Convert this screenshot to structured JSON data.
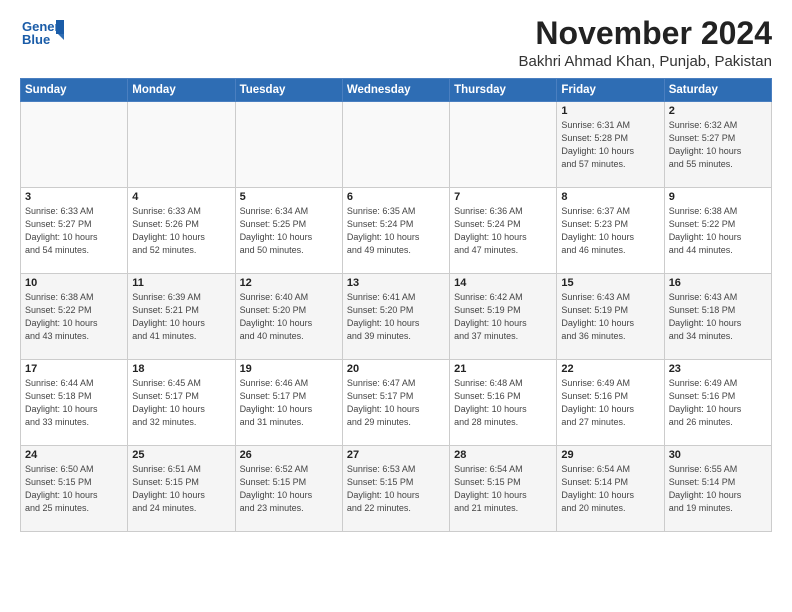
{
  "logo": {
    "line1": "General",
    "line2": "Blue"
  },
  "header": {
    "month": "November 2024",
    "location": "Bakhri Ahmad Khan, Punjab, Pakistan"
  },
  "weekdays": [
    "Sunday",
    "Monday",
    "Tuesday",
    "Wednesday",
    "Thursday",
    "Friday",
    "Saturday"
  ],
  "weeks": [
    [
      {
        "day": "",
        "info": ""
      },
      {
        "day": "",
        "info": ""
      },
      {
        "day": "",
        "info": ""
      },
      {
        "day": "",
        "info": ""
      },
      {
        "day": "",
        "info": ""
      },
      {
        "day": "1",
        "info": "Sunrise: 6:31 AM\nSunset: 5:28 PM\nDaylight: 10 hours\nand 57 minutes."
      },
      {
        "day": "2",
        "info": "Sunrise: 6:32 AM\nSunset: 5:27 PM\nDaylight: 10 hours\nand 55 minutes."
      }
    ],
    [
      {
        "day": "3",
        "info": "Sunrise: 6:33 AM\nSunset: 5:27 PM\nDaylight: 10 hours\nand 54 minutes."
      },
      {
        "day": "4",
        "info": "Sunrise: 6:33 AM\nSunset: 5:26 PM\nDaylight: 10 hours\nand 52 minutes."
      },
      {
        "day": "5",
        "info": "Sunrise: 6:34 AM\nSunset: 5:25 PM\nDaylight: 10 hours\nand 50 minutes."
      },
      {
        "day": "6",
        "info": "Sunrise: 6:35 AM\nSunset: 5:24 PM\nDaylight: 10 hours\nand 49 minutes."
      },
      {
        "day": "7",
        "info": "Sunrise: 6:36 AM\nSunset: 5:24 PM\nDaylight: 10 hours\nand 47 minutes."
      },
      {
        "day": "8",
        "info": "Sunrise: 6:37 AM\nSunset: 5:23 PM\nDaylight: 10 hours\nand 46 minutes."
      },
      {
        "day": "9",
        "info": "Sunrise: 6:38 AM\nSunset: 5:22 PM\nDaylight: 10 hours\nand 44 minutes."
      }
    ],
    [
      {
        "day": "10",
        "info": "Sunrise: 6:38 AM\nSunset: 5:22 PM\nDaylight: 10 hours\nand 43 minutes."
      },
      {
        "day": "11",
        "info": "Sunrise: 6:39 AM\nSunset: 5:21 PM\nDaylight: 10 hours\nand 41 minutes."
      },
      {
        "day": "12",
        "info": "Sunrise: 6:40 AM\nSunset: 5:20 PM\nDaylight: 10 hours\nand 40 minutes."
      },
      {
        "day": "13",
        "info": "Sunrise: 6:41 AM\nSunset: 5:20 PM\nDaylight: 10 hours\nand 39 minutes."
      },
      {
        "day": "14",
        "info": "Sunrise: 6:42 AM\nSunset: 5:19 PM\nDaylight: 10 hours\nand 37 minutes."
      },
      {
        "day": "15",
        "info": "Sunrise: 6:43 AM\nSunset: 5:19 PM\nDaylight: 10 hours\nand 36 minutes."
      },
      {
        "day": "16",
        "info": "Sunrise: 6:43 AM\nSunset: 5:18 PM\nDaylight: 10 hours\nand 34 minutes."
      }
    ],
    [
      {
        "day": "17",
        "info": "Sunrise: 6:44 AM\nSunset: 5:18 PM\nDaylight: 10 hours\nand 33 minutes."
      },
      {
        "day": "18",
        "info": "Sunrise: 6:45 AM\nSunset: 5:17 PM\nDaylight: 10 hours\nand 32 minutes."
      },
      {
        "day": "19",
        "info": "Sunrise: 6:46 AM\nSunset: 5:17 PM\nDaylight: 10 hours\nand 31 minutes."
      },
      {
        "day": "20",
        "info": "Sunrise: 6:47 AM\nSunset: 5:17 PM\nDaylight: 10 hours\nand 29 minutes."
      },
      {
        "day": "21",
        "info": "Sunrise: 6:48 AM\nSunset: 5:16 PM\nDaylight: 10 hours\nand 28 minutes."
      },
      {
        "day": "22",
        "info": "Sunrise: 6:49 AM\nSunset: 5:16 PM\nDaylight: 10 hours\nand 27 minutes."
      },
      {
        "day": "23",
        "info": "Sunrise: 6:49 AM\nSunset: 5:16 PM\nDaylight: 10 hours\nand 26 minutes."
      }
    ],
    [
      {
        "day": "24",
        "info": "Sunrise: 6:50 AM\nSunset: 5:15 PM\nDaylight: 10 hours\nand 25 minutes."
      },
      {
        "day": "25",
        "info": "Sunrise: 6:51 AM\nSunset: 5:15 PM\nDaylight: 10 hours\nand 24 minutes."
      },
      {
        "day": "26",
        "info": "Sunrise: 6:52 AM\nSunset: 5:15 PM\nDaylight: 10 hours\nand 23 minutes."
      },
      {
        "day": "27",
        "info": "Sunrise: 6:53 AM\nSunset: 5:15 PM\nDaylight: 10 hours\nand 22 minutes."
      },
      {
        "day": "28",
        "info": "Sunrise: 6:54 AM\nSunset: 5:15 PM\nDaylight: 10 hours\nand 21 minutes."
      },
      {
        "day": "29",
        "info": "Sunrise: 6:54 AM\nSunset: 5:14 PM\nDaylight: 10 hours\nand 20 minutes."
      },
      {
        "day": "30",
        "info": "Sunrise: 6:55 AM\nSunset: 5:14 PM\nDaylight: 10 hours\nand 19 minutes."
      }
    ]
  ]
}
